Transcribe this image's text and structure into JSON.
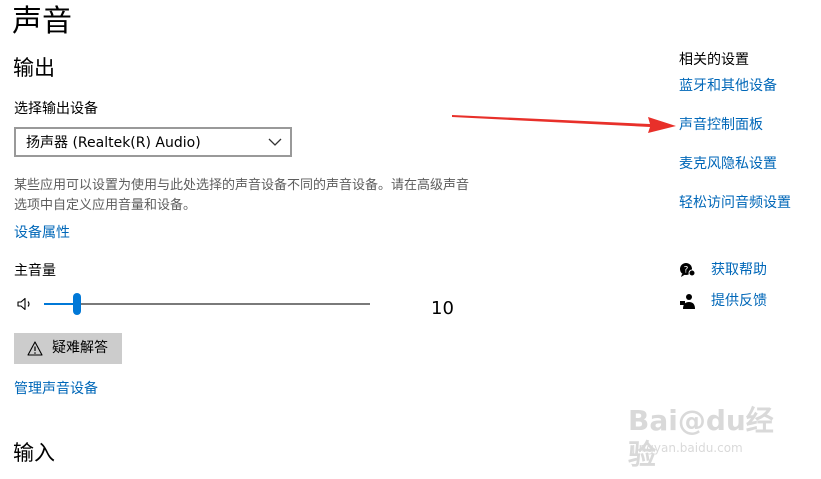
{
  "page": {
    "title": "声音"
  },
  "output": {
    "heading": "输出",
    "device_label": "选择输出设备",
    "device_value": "扬声器 (Realtek(R) Audio)",
    "description": "某些应用可以设置为使用与此处选择的声音设备不同的声音设备。请在高级声音选项中自定义应用音量和设备。",
    "device_properties_link": "设备属性",
    "master_volume_label": "主音量",
    "volume": 10,
    "volume_display": "10",
    "troubleshoot_label": "疑难解答",
    "manage_devices_link": "管理声音设备"
  },
  "input": {
    "heading": "输入"
  },
  "related": {
    "heading": "相关的设置",
    "links": [
      "蓝牙和其他设备",
      "声音控制面板",
      "麦克风隐私设置",
      "轻松访问音频设置"
    ]
  },
  "help": {
    "get_help": "获取帮助",
    "feedback": "提供反馈"
  },
  "watermark": {
    "brand": "Bai@du经验",
    "url": "jingyan.baidu.com"
  },
  "annotation": {
    "arrow_color": "#e8302a"
  },
  "colors": {
    "accent": "#0078d7",
    "link": "#0067b8"
  },
  "icons": [
    "speaker-icon",
    "chevron-down-icon",
    "warning-icon",
    "help-chat-icon",
    "feedback-person-icon"
  ]
}
